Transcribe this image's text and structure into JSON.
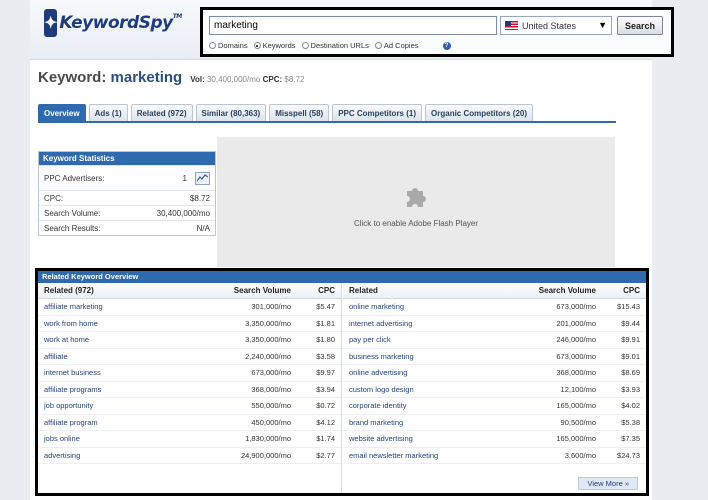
{
  "header": {
    "logo_main": "Keyword",
    "logo_spy": "Spy",
    "logo_tm": "TM",
    "search_value": "marketing",
    "country": "United States",
    "search_button": "Search",
    "radios": [
      {
        "label": "Domains",
        "checked": false
      },
      {
        "label": "Keywords",
        "checked": true
      },
      {
        "label": "Destination URLs",
        "checked": false
      },
      {
        "label": "Ad Copies",
        "checked": false
      }
    ],
    "help": "?"
  },
  "title": {
    "prefix": "Keyword:",
    "keyword": "marketing",
    "vol_label": "Vol:",
    "vol_value": "30,400,000/mo",
    "cpc_label": "CPC:",
    "cpc_value": "$8.72"
  },
  "tabs": [
    {
      "label": "Overview",
      "active": true
    },
    {
      "label": "Ads (1)",
      "active": false
    },
    {
      "label": "Related (972)",
      "active": false
    },
    {
      "label": "Similar (80,363)",
      "active": false
    },
    {
      "label": "Misspell (58)",
      "active": false
    },
    {
      "label": "PPC Competitors (1)",
      "active": false
    },
    {
      "label": "Organic Competitors (20)",
      "active": false
    }
  ],
  "stats": {
    "title": "Keyword Statistics",
    "rows": [
      {
        "label": "PPC Advertisers:",
        "value": "1"
      },
      {
        "label": "CPC:",
        "value": "$8.72"
      },
      {
        "label": "Search Volume:",
        "value": "30,400,000/mo"
      },
      {
        "label": "Search Results:",
        "value": "N/A"
      }
    ]
  },
  "flash": {
    "text": "Click to enable Adobe Flash Player"
  },
  "related": {
    "title": "Related Keyword Overview",
    "left_headers": {
      "kw": "Related (972)",
      "vol": "Search Volume",
      "cpc": "CPC"
    },
    "right_headers": {
      "kw": "Related",
      "vol": "Search Volume",
      "cpc": "CPC"
    },
    "left_rows": [
      {
        "kw": "affiliate marketing",
        "vol": "301,000/mo",
        "cpc": "$5.47"
      },
      {
        "kw": "work from home",
        "vol": "3,350,000/mo",
        "cpc": "$1.81"
      },
      {
        "kw": "work at home",
        "vol": "3,350,000/mo",
        "cpc": "$1.80"
      },
      {
        "kw": "affiliate",
        "vol": "2,240,000/mo",
        "cpc": "$3.58"
      },
      {
        "kw": "internet business",
        "vol": "673,000/mo",
        "cpc": "$9.97"
      },
      {
        "kw": "affiliate programs",
        "vol": "368,000/mo",
        "cpc": "$3.94"
      },
      {
        "kw": "job opportunity",
        "vol": "550,000/mo",
        "cpc": "$0.72"
      },
      {
        "kw": "affiliate program",
        "vol": "450,000/mo",
        "cpc": "$4.12"
      },
      {
        "kw": "jobs online",
        "vol": "1,830,000/mo",
        "cpc": "$1.74"
      },
      {
        "kw": "advertising",
        "vol": "24,900,000/mo",
        "cpc": "$2.77"
      }
    ],
    "right_rows": [
      {
        "kw": "online marketing",
        "vol": "673,000/mo",
        "cpc": "$15.43"
      },
      {
        "kw": "internet advertising",
        "vol": "201,000/mo",
        "cpc": "$9.44"
      },
      {
        "kw": "pay per click",
        "vol": "246,000/mo",
        "cpc": "$9.91"
      },
      {
        "kw": "business marketing",
        "vol": "673,000/mo",
        "cpc": "$9.01"
      },
      {
        "kw": "online advertising",
        "vol": "368,000/mo",
        "cpc": "$8.69"
      },
      {
        "kw": "custom logo design",
        "vol": "12,100/mo",
        "cpc": "$3.93"
      },
      {
        "kw": "corporate identity",
        "vol": "165,000/mo",
        "cpc": "$4.02"
      },
      {
        "kw": "brand marketing",
        "vol": "90,500/mo",
        "cpc": "$5.38"
      },
      {
        "kw": "website advertising",
        "vol": "165,000/mo",
        "cpc": "$7.35"
      },
      {
        "kw": "email newsletter marketing",
        "vol": "3,600/mo",
        "cpc": "$24.73"
      }
    ],
    "view_more": "View More »"
  }
}
